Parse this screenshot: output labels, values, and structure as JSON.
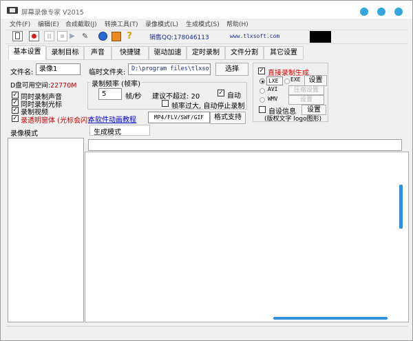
{
  "window": {
    "title": "屏幕录像专家 V2015"
  },
  "menu": [
    "文件(F)",
    "编辑(E)",
    "合成截取(J)",
    "转换工具(T)",
    "录像模式(L)",
    "生成模式(S)",
    "帮助(H)"
  ],
  "toolbar": {
    "sales_qq": "销售QQ:178046113",
    "website": "www.tlxsoft.com"
  },
  "tabs": [
    "基本设置",
    "录制目标",
    "声音",
    "快捷键",
    "驱动加速",
    "定时录制",
    "文件分割",
    "其它设置"
  ],
  "basic": {
    "filename_label": "文件名:",
    "filename_value": "录像1",
    "tempdir_label": "临时文件夹:",
    "tempdir_value": "D:\\program files\\tlxsof",
    "choose_button": "选择",
    "disk_label": "D盘可用空间:",
    "disk_value": "22770M",
    "rec_audio": "同时录制声音",
    "rec_cursor": "同时录制光标",
    "rec_video": "录制视频",
    "transparent": "录透明窗体 (光标会闪)",
    "tutorial_link": "本软件动画教程",
    "formats_label": "MP4/FLV/SWF/GIF",
    "format_support_button": "格式支持",
    "fps_group": "录制频率 (帧率)",
    "fps_value": "5",
    "fps_unit": "帧/秒",
    "fps_hint": "建议不超过: 20",
    "auto": "自动",
    "auto_stop": "帧率过大, 自动停止录制",
    "direct_gen": "直接录制生成",
    "lxe": "LXE",
    "exe": "EXE",
    "settings": "设置",
    "avi": "AVI",
    "compress_settings": "压缩设置",
    "wmv": "WMV",
    "wmv_settings": "设置",
    "custom_info": "自设信息",
    "custom_settings": "设置",
    "copyright": "(版权文字 logo图形)"
  },
  "panels": {
    "record_mode": "录像模式",
    "gen_mode": "生成模式"
  }
}
